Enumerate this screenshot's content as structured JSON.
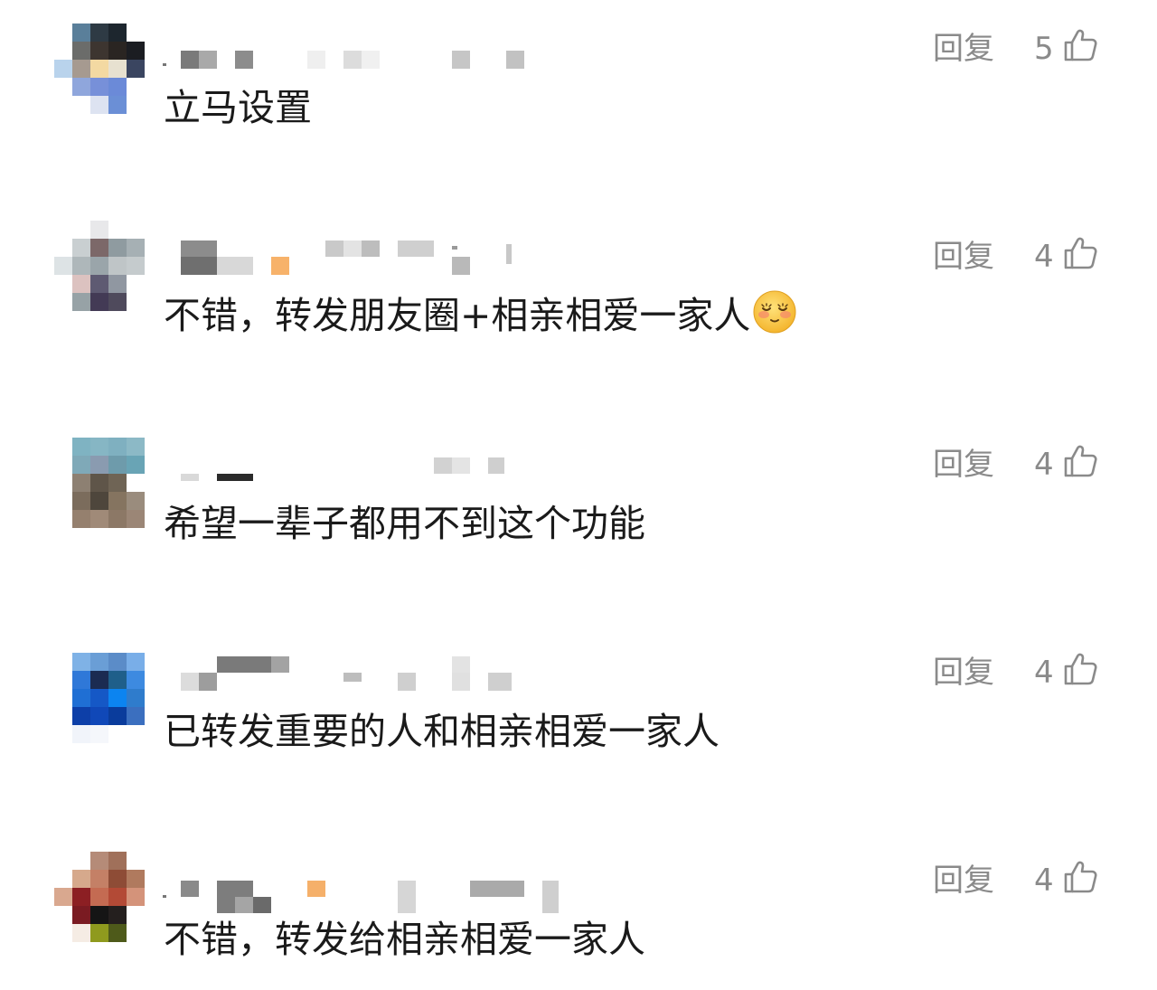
{
  "comments": [
    {
      "text": "立马设置",
      "reply_label": "回复",
      "likes": "5",
      "has_emoji": false
    },
    {
      "text": "不错，转发朋友圈+相亲相爱一家人",
      "reply_label": "回复",
      "likes": "4",
      "has_emoji": true,
      "emoji": "blushing-face-emoji"
    },
    {
      "text": "希望一辈子都用不到这个功能",
      "reply_label": "回复",
      "likes": "4",
      "has_emoji": false
    },
    {
      "text": "已转发重要的人和相亲相爱一家人",
      "reply_label": "回复",
      "likes": "4",
      "has_emoji": false
    },
    {
      "text": "不错，转发给相亲相爱一家人",
      "reply_label": "回复",
      "likes": "4",
      "has_emoji": false
    }
  ],
  "icons": {
    "like": "thumbs-up-icon"
  },
  "colors": {
    "text": "#1a1a1a",
    "muted": "#8a8a8a",
    "background": "#ffffff"
  }
}
